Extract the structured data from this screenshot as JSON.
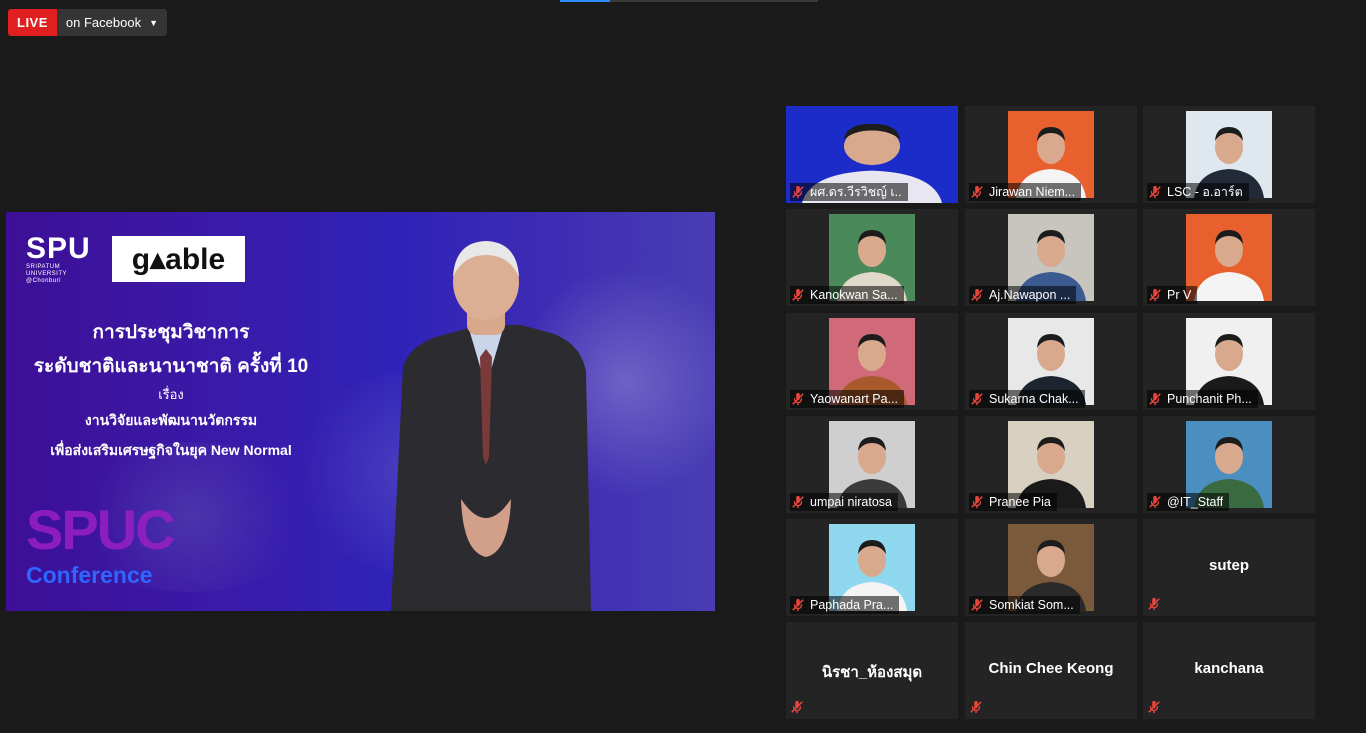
{
  "live": {
    "badge": "LIVE",
    "destination": "on Facebook"
  },
  "share": {
    "spu_logo": "SPU",
    "spu_sub1": "SRIPATUM",
    "spu_sub2": "UNIVERSITY",
    "spu_sub3": "@Chonburi",
    "gable_logo": "g▴able",
    "line1": "การประชุมวิชาการ",
    "line2": "ระดับชาติและนานาชาติ ครั้งที่ 10",
    "line3": "เรื่อง",
    "line4": "งานวิจัยและพัฒนานวัตกรรม",
    "line5": "เพื่อส่งเสริมเศรษฐกิจในยุค New Normal",
    "brand1": "SPUC",
    "brand2": "Conference"
  },
  "participants": [
    {
      "name": "ผศ.ดร.วีรวิชญ์ เ..",
      "video": true
    },
    {
      "name": "Jirawan Niem...",
      "video": true
    },
    {
      "name": "LSC - อ.อาร์ต",
      "video": true
    },
    {
      "name": "Kanokwan Sa...",
      "video": true
    },
    {
      "name": "Aj.Nawapon ...",
      "video": true
    },
    {
      "name": "Pr V",
      "video": true
    },
    {
      "name": "Yaowanart Pa...",
      "video": true
    },
    {
      "name": "Sukarna Chak...",
      "video": true
    },
    {
      "name": "Punchanit Ph...",
      "video": true
    },
    {
      "name": "umpai niratosa",
      "video": true
    },
    {
      "name": "Pranee Pia",
      "video": true
    },
    {
      "name": "@IT_Staff",
      "video": true
    },
    {
      "name": "Paphada Pra...",
      "video": true
    },
    {
      "name": "Somkiat Som...",
      "video": true
    },
    {
      "name": "sutep",
      "video": false
    },
    {
      "name": "นิรชา_ห้องสมุด",
      "video": false
    },
    {
      "name": "Chin Chee Keong",
      "video": false
    },
    {
      "name": "kanchana",
      "video": false
    }
  ],
  "colors": {
    "live": "#e02020",
    "background": "#1a1a1a",
    "tile": "#242424",
    "mute": "#e8463c"
  }
}
